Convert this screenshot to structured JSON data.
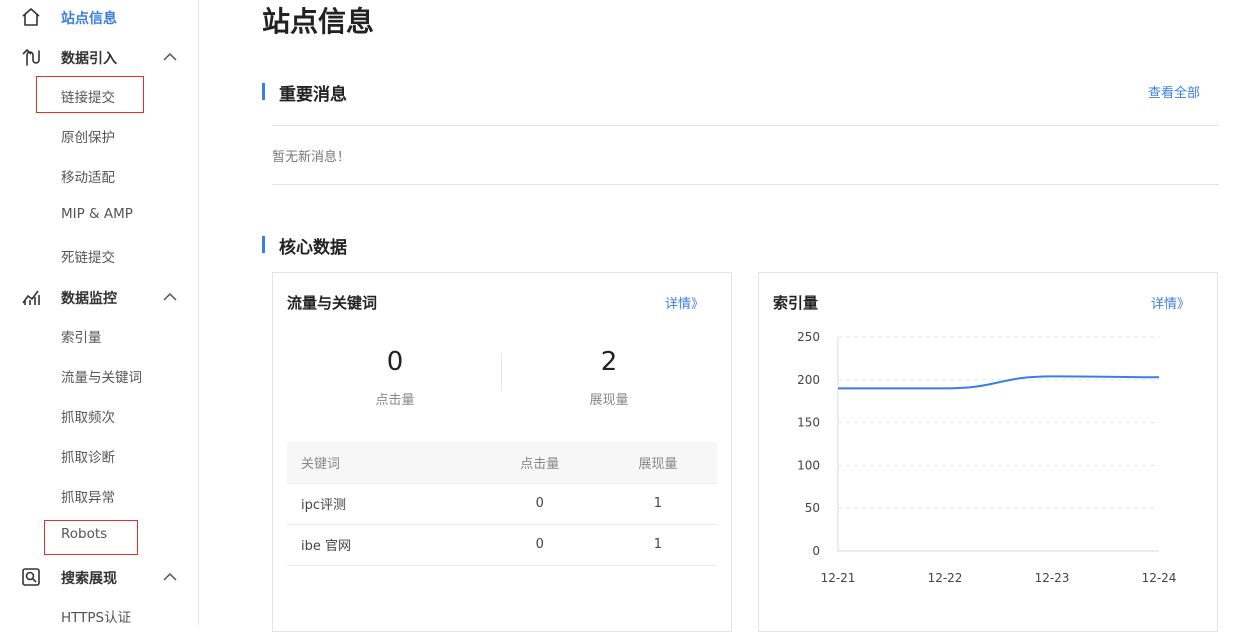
{
  "sidebar": {
    "home": {
      "label": "站点信息"
    },
    "groups": [
      {
        "label": "数据引入",
        "items": [
          "链接提交",
          "原创保护",
          "移动适配",
          "MIP & AMP",
          "死链提交"
        ]
      },
      {
        "label": "数据监控",
        "items": [
          "索引量",
          "流量与关键词",
          "抓取频次",
          "抓取诊断",
          "抓取异常",
          "Robots"
        ]
      },
      {
        "label": "搜索展现",
        "items": [
          "HTTPS认证"
        ]
      }
    ]
  },
  "main": {
    "title": "站点信息",
    "messages": {
      "title": "重要消息",
      "view_all": "查看全部",
      "empty": "暂无新消息！"
    },
    "core": {
      "title": "核心数据"
    },
    "traffic_card": {
      "title": "流量与关键词",
      "detail": "详情》",
      "clicks": {
        "value": "0",
        "label": "点击量"
      },
      "impressions": {
        "value": "2",
        "label": "展现量"
      },
      "table": {
        "headers": [
          "关键词",
          "点击量",
          "展现量"
        ],
        "rows": [
          [
            "ipc评测",
            "0",
            "1"
          ],
          [
            "ibe 官网",
            "0",
            "1"
          ]
        ]
      }
    },
    "index_card": {
      "title": "索引量",
      "detail": "详情》"
    }
  },
  "chart_data": {
    "type": "line",
    "categories": [
      "12-21",
      "12-22",
      "12-23",
      "12-24"
    ],
    "series": [
      {
        "values": [
          190,
          190,
          204,
          203
        ]
      }
    ],
    "yticks": [
      0,
      50,
      100,
      150,
      200,
      250
    ],
    "ylim": [
      0,
      250
    ],
    "grid": true,
    "line_color": "#3a7ee4"
  },
  "colors": {
    "accent": "#3a7ee4",
    "highlight_box": "#e0302b"
  }
}
